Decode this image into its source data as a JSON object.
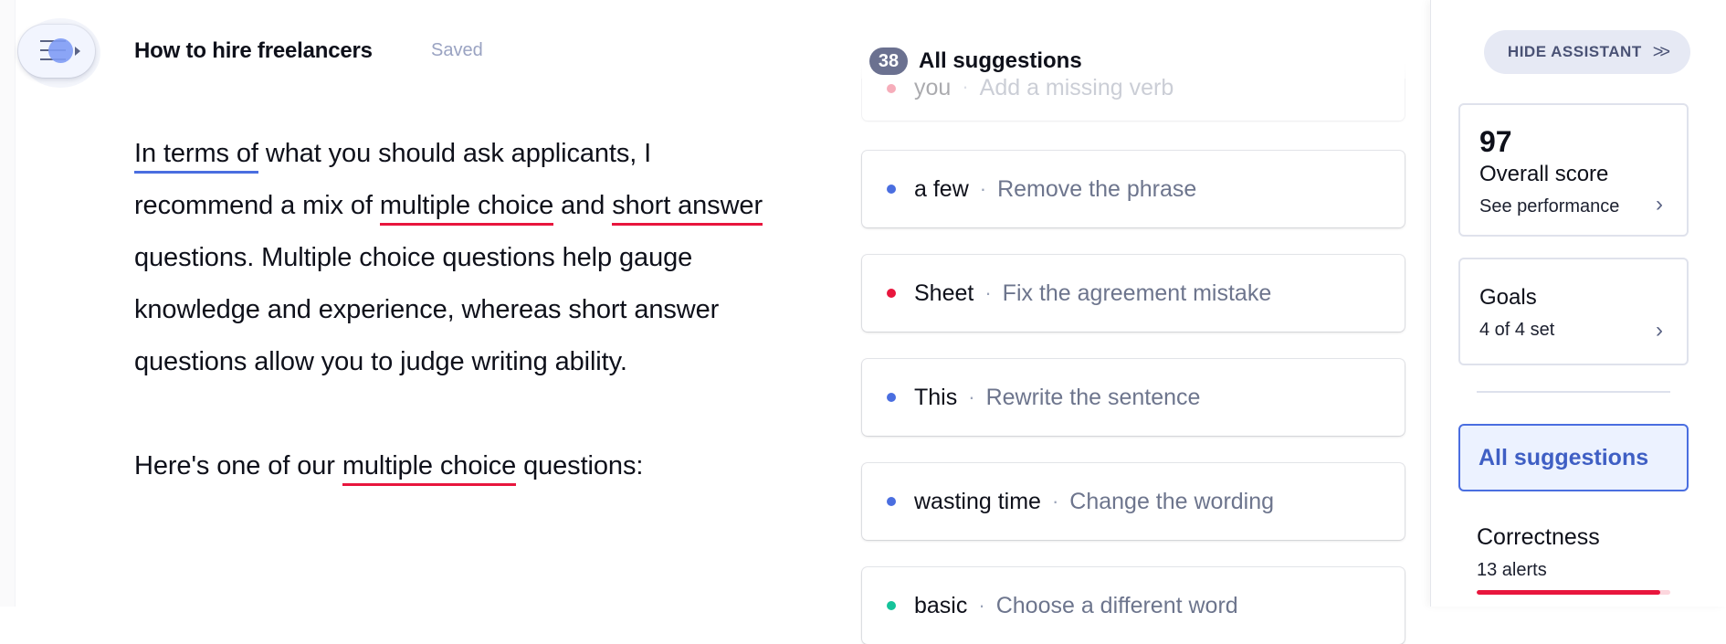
{
  "header": {
    "menu_icon": "menu-collapse-icon",
    "title": "How to hire freelancers",
    "status": "Saved"
  },
  "editor": {
    "paragraphs": [
      [
        {
          "text": "In terms of",
          "mark": "blue"
        },
        {
          "text": " what you should ask applicants, I recommend a mix of "
        },
        {
          "text": "multiple choice",
          "mark": "red"
        },
        {
          "text": " and "
        },
        {
          "text": "short answer",
          "mark": "red"
        },
        {
          "text": " questions. Multiple choice questions help gauge knowledge and experience, whereas short answer questions allow you to judge writing ability."
        }
      ],
      [
        {
          "text": "Here's one of our "
        },
        {
          "text": "multiple choice",
          "mark": "red"
        },
        {
          "text": " questions:"
        }
      ]
    ]
  },
  "suggestions": {
    "count": "38",
    "title": "All suggestions",
    "items": [
      {
        "word": "you",
        "desc": "Add a missing verb",
        "color": "#e8163d",
        "faded": true
      },
      {
        "word": "a few",
        "desc": "Remove the phrase",
        "color": "#4a6ee0"
      },
      {
        "word": "Sheet",
        "desc": "Fix the agreement mistake",
        "color": "#e8163d"
      },
      {
        "word": "This",
        "desc": "Rewrite the sentence",
        "color": "#4a6ee0"
      },
      {
        "word": "wasting time",
        "desc": "Change the wording",
        "color": "#4a6ee0"
      },
      {
        "word": "basic",
        "desc": "Choose a different word",
        "color": "#15c39a"
      }
    ]
  },
  "sidebar": {
    "hide_label": "HIDE ASSISTANT",
    "hide_icon": "double-chevron-right-icon",
    "score": {
      "value": "97",
      "label": "Overall score",
      "link": "See performance"
    },
    "goals": {
      "label": "Goals",
      "sub": "4 of 4 set"
    },
    "nav_active": "All suggestions",
    "category": {
      "label": "Correctness",
      "sub": "13 alerts",
      "progress_percent": 95,
      "color": "#e8163d"
    }
  }
}
